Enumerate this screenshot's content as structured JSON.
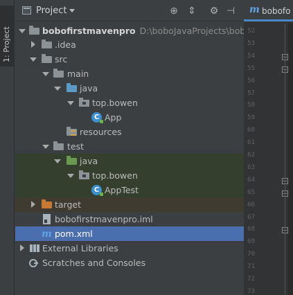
{
  "sidebar_tab": {
    "label": "1: Project"
  },
  "panel": {
    "title": "Project"
  },
  "tree": {
    "root": {
      "name": "bobofirstmavenpro",
      "path": "D:\\boboJavaProjects\\bobofi"
    },
    "idea": ".idea",
    "src": "src",
    "main": "main",
    "main_java": "java",
    "main_pkg": "top.bowen",
    "app": "App",
    "resources": "resources",
    "test": "test",
    "test_java": "java",
    "test_pkg": "top.bowen",
    "apptest": "AppTest",
    "target": "target",
    "iml": "bobofirstmavenpro.iml",
    "pom": "pom.xml",
    "ext_libs": "External Libraries",
    "scratches": "Scratches and Consoles"
  },
  "editor": {
    "tab_label": "bobofo",
    "line_numbers": [
      "52",
      "53",
      "54",
      "55",
      "56",
      "57",
      "58",
      "59",
      "60",
      "61",
      "62",
      "63",
      "64",
      "65",
      "66",
      "67",
      "68",
      "69",
      "70",
      "71",
      "72",
      "73"
    ]
  },
  "colors": {
    "background": "#3c3f41",
    "selection": "#4b6eaf",
    "test_highlight": "#34402d",
    "excluded_highlight": "#3f3b30",
    "maven_blue": "#5fa3e6"
  }
}
